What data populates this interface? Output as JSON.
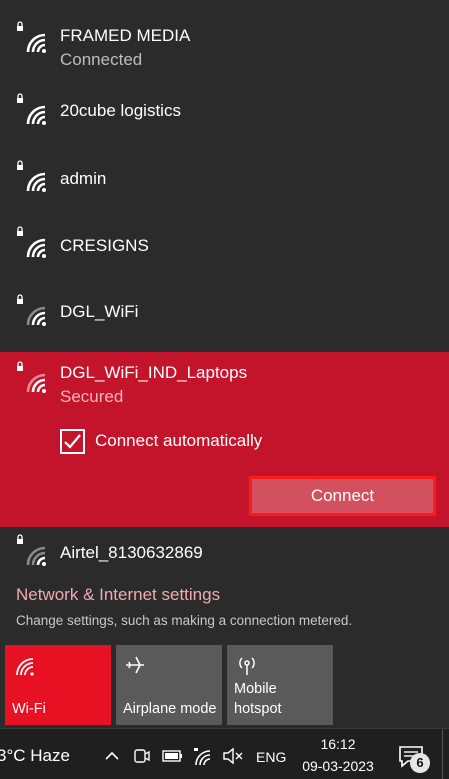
{
  "networks": [
    {
      "name": "FRAMED MEDIA",
      "status": "Connected",
      "secured": true
    },
    {
      "name": "20cube logistics",
      "secured": true
    },
    {
      "name": "admin",
      "secured": true
    },
    {
      "name": "CRESIGNS",
      "secured": true
    },
    {
      "name": "DGL_WiFi",
      "secured": true
    },
    {
      "name": "DGL_WiFi_IND_Laptops",
      "status": "Secured",
      "secured": true,
      "selected": true
    },
    {
      "name": "Airtel_8130632869",
      "secured": true
    }
  ],
  "selected_network": {
    "connect_automatically_label": "Connect automatically",
    "connect_automatically_checked": true,
    "connect_button_label": "Connect"
  },
  "settings": {
    "link_label": "Network & Internet settings",
    "description": "Change settings, such as making a connection metered."
  },
  "quick_actions": [
    {
      "label": "Wi-Fi",
      "icon": "wifi-icon",
      "active": true
    },
    {
      "label": "Airplane mode",
      "icon": "airplane-icon",
      "active": false
    },
    {
      "label": "Mobile hotspot",
      "icon": "hotspot-icon",
      "active": false
    }
  ],
  "taskbar": {
    "weather": "3°C  Haze",
    "language": "ENG",
    "time": "16:12",
    "date": "09-03-2023",
    "notification_count": "6"
  },
  "colors": {
    "panel_bg": "#2b2b2b",
    "selected_bg": "#c4142b",
    "accent_tile": "#e81123",
    "inactive_tile": "#5a5a5a",
    "connect_highlight": "#ff1a1a",
    "settings_link": "#f2a9b3"
  }
}
